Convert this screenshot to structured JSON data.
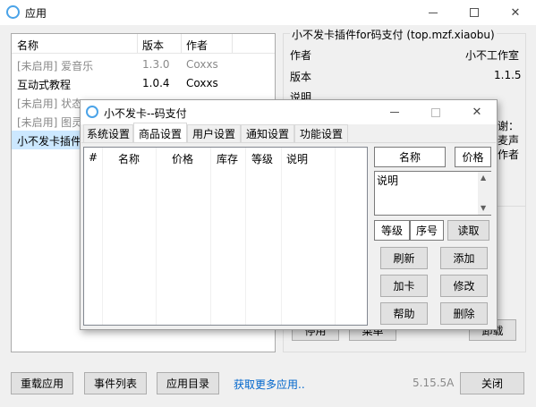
{
  "main_window": {
    "title": "应用",
    "list": {
      "columns": [
        "名称",
        "版本",
        "作者"
      ],
      "rows": [
        {
          "name": "[未启用] 爱音乐",
          "version": "1.3.0",
          "author": "Coxxs",
          "state": "disabled"
        },
        {
          "name": "互动式教程",
          "version": "1.0.4",
          "author": "Coxxs",
          "state": "enabled"
        },
        {
          "name": "[未启用] 状态",
          "version": "",
          "author": "",
          "state": "disabled"
        },
        {
          "name": "[未启用] 图灵",
          "version": "",
          "author": "",
          "state": "disabled"
        },
        {
          "name": "小不发卡插件",
          "version": "",
          "author": "",
          "state": "selected"
        }
      ]
    },
    "info": {
      "title": "小不发卡插件for码支付 (top.mzf.xiaobu)",
      "author_label": "作者",
      "author_value": "小不工作室",
      "version_label": "版本",
      "version_value": "1.1.5",
      "desc_label": "说明",
      "partial_text_1": "谢：",
      "partial_text_2": "麦声",
      "partial_text_3": "作者",
      "btn_disable": "停用",
      "btn_menu": "菜单",
      "btn_uninstall": "卸载"
    },
    "bottom": {
      "reload": "重载应用",
      "events": "事件列表",
      "app_dir": "应用目录",
      "more_apps": "获取更多应用..",
      "version": "5.15.5A",
      "close": "关闭"
    }
  },
  "dialog": {
    "title": "小不发卡--码支付",
    "tabs": [
      "系统设置",
      "商品设置",
      "用户设置",
      "通知设置",
      "功能设置"
    ],
    "active_tab": "商品设置",
    "table_columns": [
      "#",
      "名称",
      "价格",
      "库存",
      "等级",
      "说明"
    ],
    "form": {
      "name": "名称",
      "price": "价格",
      "desc": "说明",
      "level": "等级",
      "order": "序号",
      "read": "读取"
    },
    "buttons": {
      "refresh": "刷新",
      "add": "添加",
      "add_card": "加卡",
      "edit": "修改",
      "help": "帮助",
      "delete": "删除"
    }
  }
}
